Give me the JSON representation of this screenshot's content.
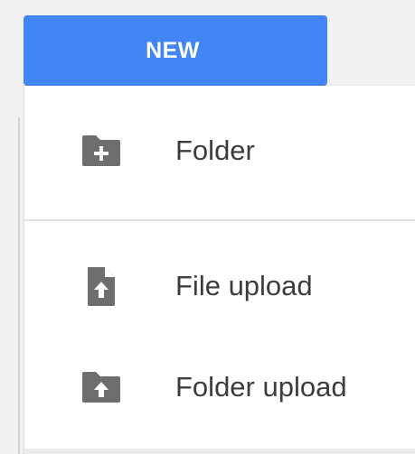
{
  "new_button": {
    "label": "NEW"
  },
  "menu": {
    "items": [
      {
        "label": "Folder",
        "icon": "folder-plus-icon"
      },
      {
        "label": "File upload",
        "icon": "file-upload-icon"
      },
      {
        "label": "Folder upload",
        "icon": "folder-upload-icon"
      }
    ]
  },
  "colors": {
    "accent": "#4285f4",
    "icon": "#6e6e6e",
    "text": "#3c3c3c",
    "divider": "#e2e2e2"
  }
}
